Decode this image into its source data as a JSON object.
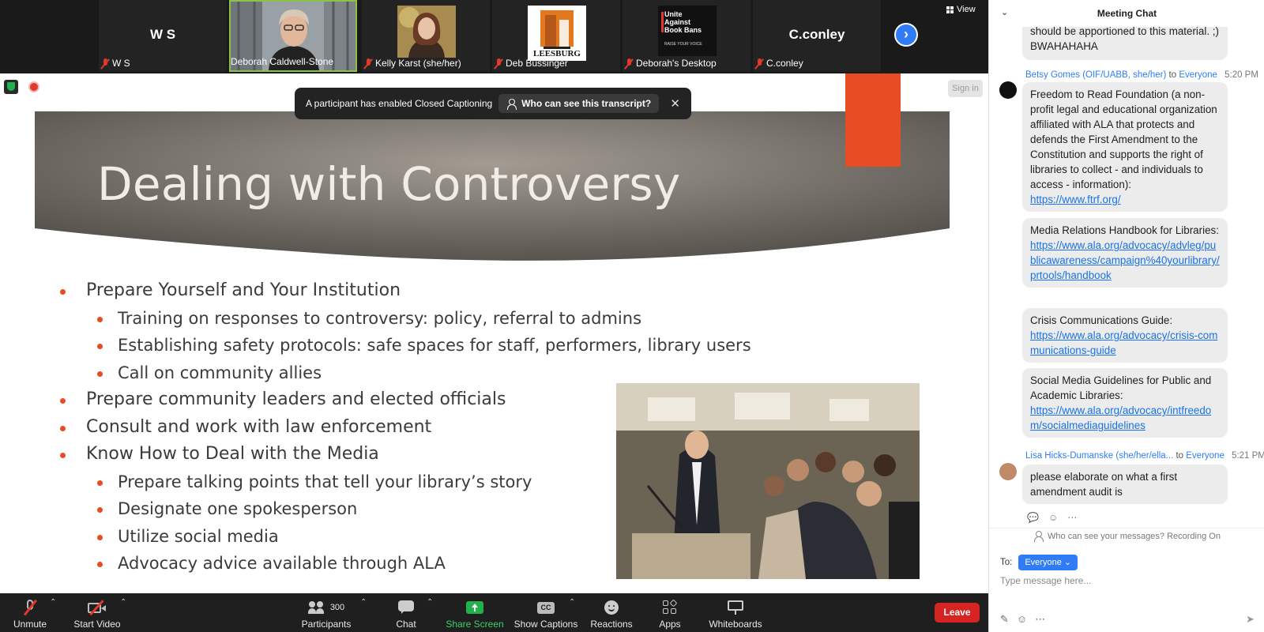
{
  "participants": [
    {
      "display_name": "W S",
      "label": "W S",
      "kind": "name"
    },
    {
      "display_name": "",
      "label": "Deborah Caldwell-Stone",
      "kind": "video-person",
      "active": true
    },
    {
      "display_name": "",
      "label": "Kelly Karst (she/her)",
      "kind": "photo-woman"
    },
    {
      "display_name": "",
      "label": "Deb Bussinger",
      "kind": "logo-leesburg",
      "logo_text": "LEESBURG"
    },
    {
      "display_name": "",
      "label": "Deborah's Desktop",
      "kind": "logo-uab",
      "logo_line1": "Unite",
      "logo_line2": "Against",
      "logo_line3": "Book Bans",
      "logo_line4": "RAISE YOUR VOICE"
    },
    {
      "display_name": "C.conley",
      "label": "C.conley",
      "kind": "name"
    }
  ],
  "view_label": "View",
  "share": {
    "sign_in": "Sign in",
    "cc_notice": "A participant has enabled Closed Captioning",
    "cc_who": "Who can see this transcript?",
    "close_glyph": "✕",
    "slide": {
      "title": "Dealing with Controversy",
      "bullets": [
        {
          "level": 1,
          "text": "Prepare Yourself and Your Institution"
        },
        {
          "level": 2,
          "text": "Training on responses to controversy: policy, referral to admins"
        },
        {
          "level": 2,
          "text": "Establishing safety protocols: safe spaces for staff, performers, library users"
        },
        {
          "level": 2,
          "text": "Call on community allies"
        },
        {
          "level": 1,
          "text": "Prepare community leaders and elected officials"
        },
        {
          "level": 1,
          "text": "Consult and work with law enforcement"
        },
        {
          "level": 1,
          "text": "Know How to Deal with the Media"
        },
        {
          "level": 2,
          "text": "Prepare talking points that tell your library’s story"
        },
        {
          "level": 2,
          "text": "Designate one spokesperson"
        },
        {
          "level": 2,
          "text": "Utilize social media"
        },
        {
          "level": 2,
          "text": "Advocacy advice available through ALA"
        }
      ]
    }
  },
  "toolbar": {
    "unmute": "Unmute",
    "start_video": "Start Video",
    "participants": "Participants",
    "participant_count": "300",
    "chat": "Chat",
    "share_screen": "Share Screen",
    "show_captions": "Show Captions",
    "cc_glyph": "CC",
    "reactions": "Reactions",
    "apps": "Apps",
    "whiteboards": "Whiteboards",
    "leave": "Leave"
  },
  "chat": {
    "title": "Meeting Chat",
    "partial_message": "should be apportioned to this material. ;) BWAHAHAHA",
    "msg1": {
      "sender": "Betsy Gomes (OIF/UABB, she/her)",
      "to": "to",
      "recipient": "Everyone",
      "time": "5:20 PM",
      "text": "Freedom to Read Foundation (a non-profit legal and educational organization affiliated with ALA that protects and defends the First Amendment to the Constitution and supports the right of libraries to collect - and individuals to access - information): ",
      "link": "https://www.ftrf.org/"
    },
    "msg2": {
      "text": "Media Relations Handbook for Libraries:",
      "link": "https://www.ala.org/advocacy/advleg/publicawareness/campaign%40yourlibrary/prtools/handbook"
    },
    "msg3": {
      "text": "Crisis Communications Guide:",
      "link": "https://www.ala.org/advocacy/crisis-communications-guide"
    },
    "msg4": {
      "text": "Social Media Guidelines for Public and Academic Libraries:",
      "link": "https://www.ala.org/advocacy/intfreedom/socialmediaguidelines"
    },
    "msg5": {
      "sender": "Lisa Hicks-Dumanske (she/her/ella...",
      "to": "to",
      "recipient": "Everyone",
      "time": "5:21 PM",
      "text": "please elaborate on what a first amendment audit is"
    },
    "who_can_see": "Who can see your messages? Recording On",
    "to_label": "To:",
    "to_value": "Everyone",
    "input_placeholder": "Type message here..."
  },
  "colors": {
    "accent": "#2f7cf6",
    "slide_accent": "#e84c22",
    "leave": "#d82323",
    "share_green": "#22b14c"
  }
}
